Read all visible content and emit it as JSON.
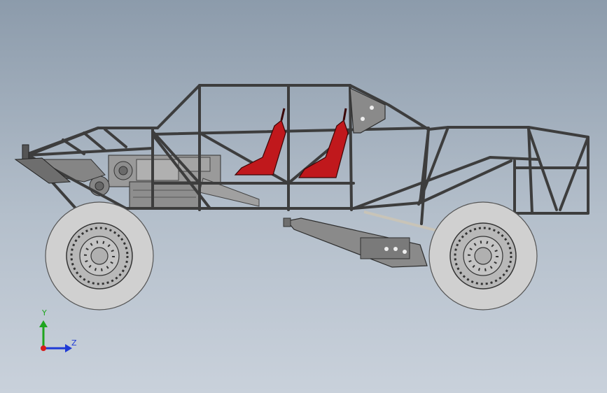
{
  "viewport": {
    "background_top": "#8c9bab",
    "background_bottom": "#c9d1db"
  },
  "model": {
    "frame_color": "#3d3d3d",
    "seat_color": "#c0181c",
    "tire_color": "#d0d0d0",
    "rim_color": "#b8b8b8",
    "plate_color": "#8a8a8a",
    "engine_color": "#9a9a9a"
  },
  "triad": {
    "y_label": "Y",
    "z_label": "Z",
    "y_color": "#1fa51f",
    "z_color": "#1f3ad6",
    "origin_color": "#d81b1b"
  }
}
